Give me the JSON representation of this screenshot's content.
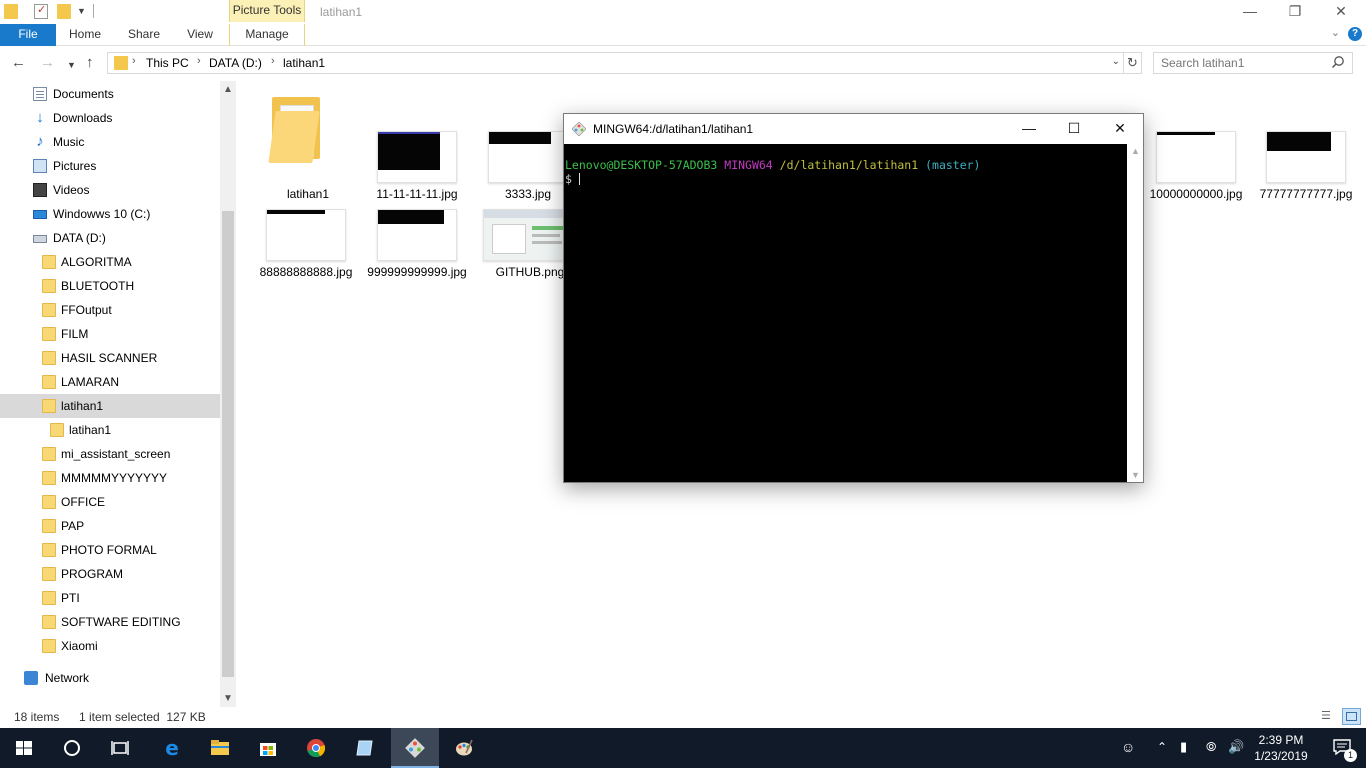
{
  "titlebar": {
    "contextual_tab": "Picture Tools",
    "window_title": "latihan1",
    "minimize": "—",
    "restore": "❐",
    "close": "✕"
  },
  "ribbon": {
    "tabs": [
      "File",
      "Home",
      "Share",
      "View",
      "Manage"
    ],
    "help": "?"
  },
  "address": {
    "crumbs": [
      "This PC",
      "DATA (D:)",
      "latihan1"
    ],
    "search_placeholder": "Search latihan1"
  },
  "nav_pane": {
    "items": [
      {
        "label": "Documents",
        "icon": "documents-icon"
      },
      {
        "label": "Downloads",
        "icon": "downloads-icon"
      },
      {
        "label": "Music",
        "icon": "music-icon"
      },
      {
        "label": "Pictures",
        "icon": "pictures-icon"
      },
      {
        "label": "Videos",
        "icon": "videos-icon"
      },
      {
        "label": "Windowws 10 (C:)",
        "icon": "drive-c-icon"
      },
      {
        "label": "DATA (D:)",
        "icon": "drive-d-icon"
      },
      {
        "label": "ALGORITMA",
        "icon": "folder-icon"
      },
      {
        "label": "BLUETOOTH",
        "icon": "folder-icon"
      },
      {
        "label": "FFOutput",
        "icon": "folder-icon"
      },
      {
        "label": "FILM",
        "icon": "folder-icon"
      },
      {
        "label": "HASIL SCANNER",
        "icon": "folder-icon"
      },
      {
        "label": "LAMARAN",
        "icon": "folder-icon"
      },
      {
        "label": "latihan1",
        "icon": "folder-icon",
        "selected": true
      },
      {
        "label": "latihan1",
        "icon": "folder-icon"
      },
      {
        "label": "mi_assistant_screen",
        "icon": "folder-icon"
      },
      {
        "label": "MMMMMYYYYYYY",
        "icon": "folder-icon"
      },
      {
        "label": "OFFICE",
        "icon": "folder-icon"
      },
      {
        "label": "PAP",
        "icon": "folder-icon"
      },
      {
        "label": "PHOTO FORMAL",
        "icon": "folder-icon"
      },
      {
        "label": "PROGRAM",
        "icon": "folder-icon"
      },
      {
        "label": "PTI",
        "icon": "folder-icon"
      },
      {
        "label": "SOFTWARE EDITING",
        "icon": "folder-icon"
      },
      {
        "label": "Xiaomi",
        "icon": "folder-icon"
      },
      {
        "label": "Network",
        "icon": "network-icon"
      }
    ]
  },
  "files": [
    {
      "name": "latihan1",
      "kind": "folder"
    },
    {
      "name": "11-11-11-11.jpg",
      "kind": "image"
    },
    {
      "name": "3333.jpg",
      "kind": "image"
    },
    {
      "name": "10000000000.jpg",
      "kind": "image"
    },
    {
      "name": "77777777777.jpg",
      "kind": "image"
    },
    {
      "name": "88888888888.jpg",
      "kind": "image"
    },
    {
      "name": "999999999999.jpg",
      "kind": "image"
    },
    {
      "name": "GITHUB.png",
      "kind": "image"
    }
  ],
  "status": {
    "item_count": "18 items",
    "selection": "1 item selected  127 KB"
  },
  "terminal": {
    "title": "MINGW64:/d/latihan1/latihan1",
    "prompt_user": "Lenovo@DESKTOP-57ADOB3",
    "prompt_env": "MINGW64",
    "prompt_path": "/d/latihan1/latihan1",
    "prompt_branch": "(master)",
    "prompt_symbol": "$",
    "colors": {
      "user": "#3ac04a",
      "env": "#c13ac0",
      "path": "#c0c03a",
      "branch": "#3ab0c0"
    }
  },
  "taskbar": {
    "apps": [
      "start-icon",
      "cortana-icon",
      "task-view-icon",
      "edge-icon",
      "file-explorer-icon",
      "store-icon",
      "chrome-icon",
      "notepad-icon",
      "git-bash-icon",
      "paint-icon"
    ],
    "active_app": "git-bash-icon",
    "time": "2:39 PM",
    "date": "1/23/2019",
    "notification_count": "1"
  }
}
